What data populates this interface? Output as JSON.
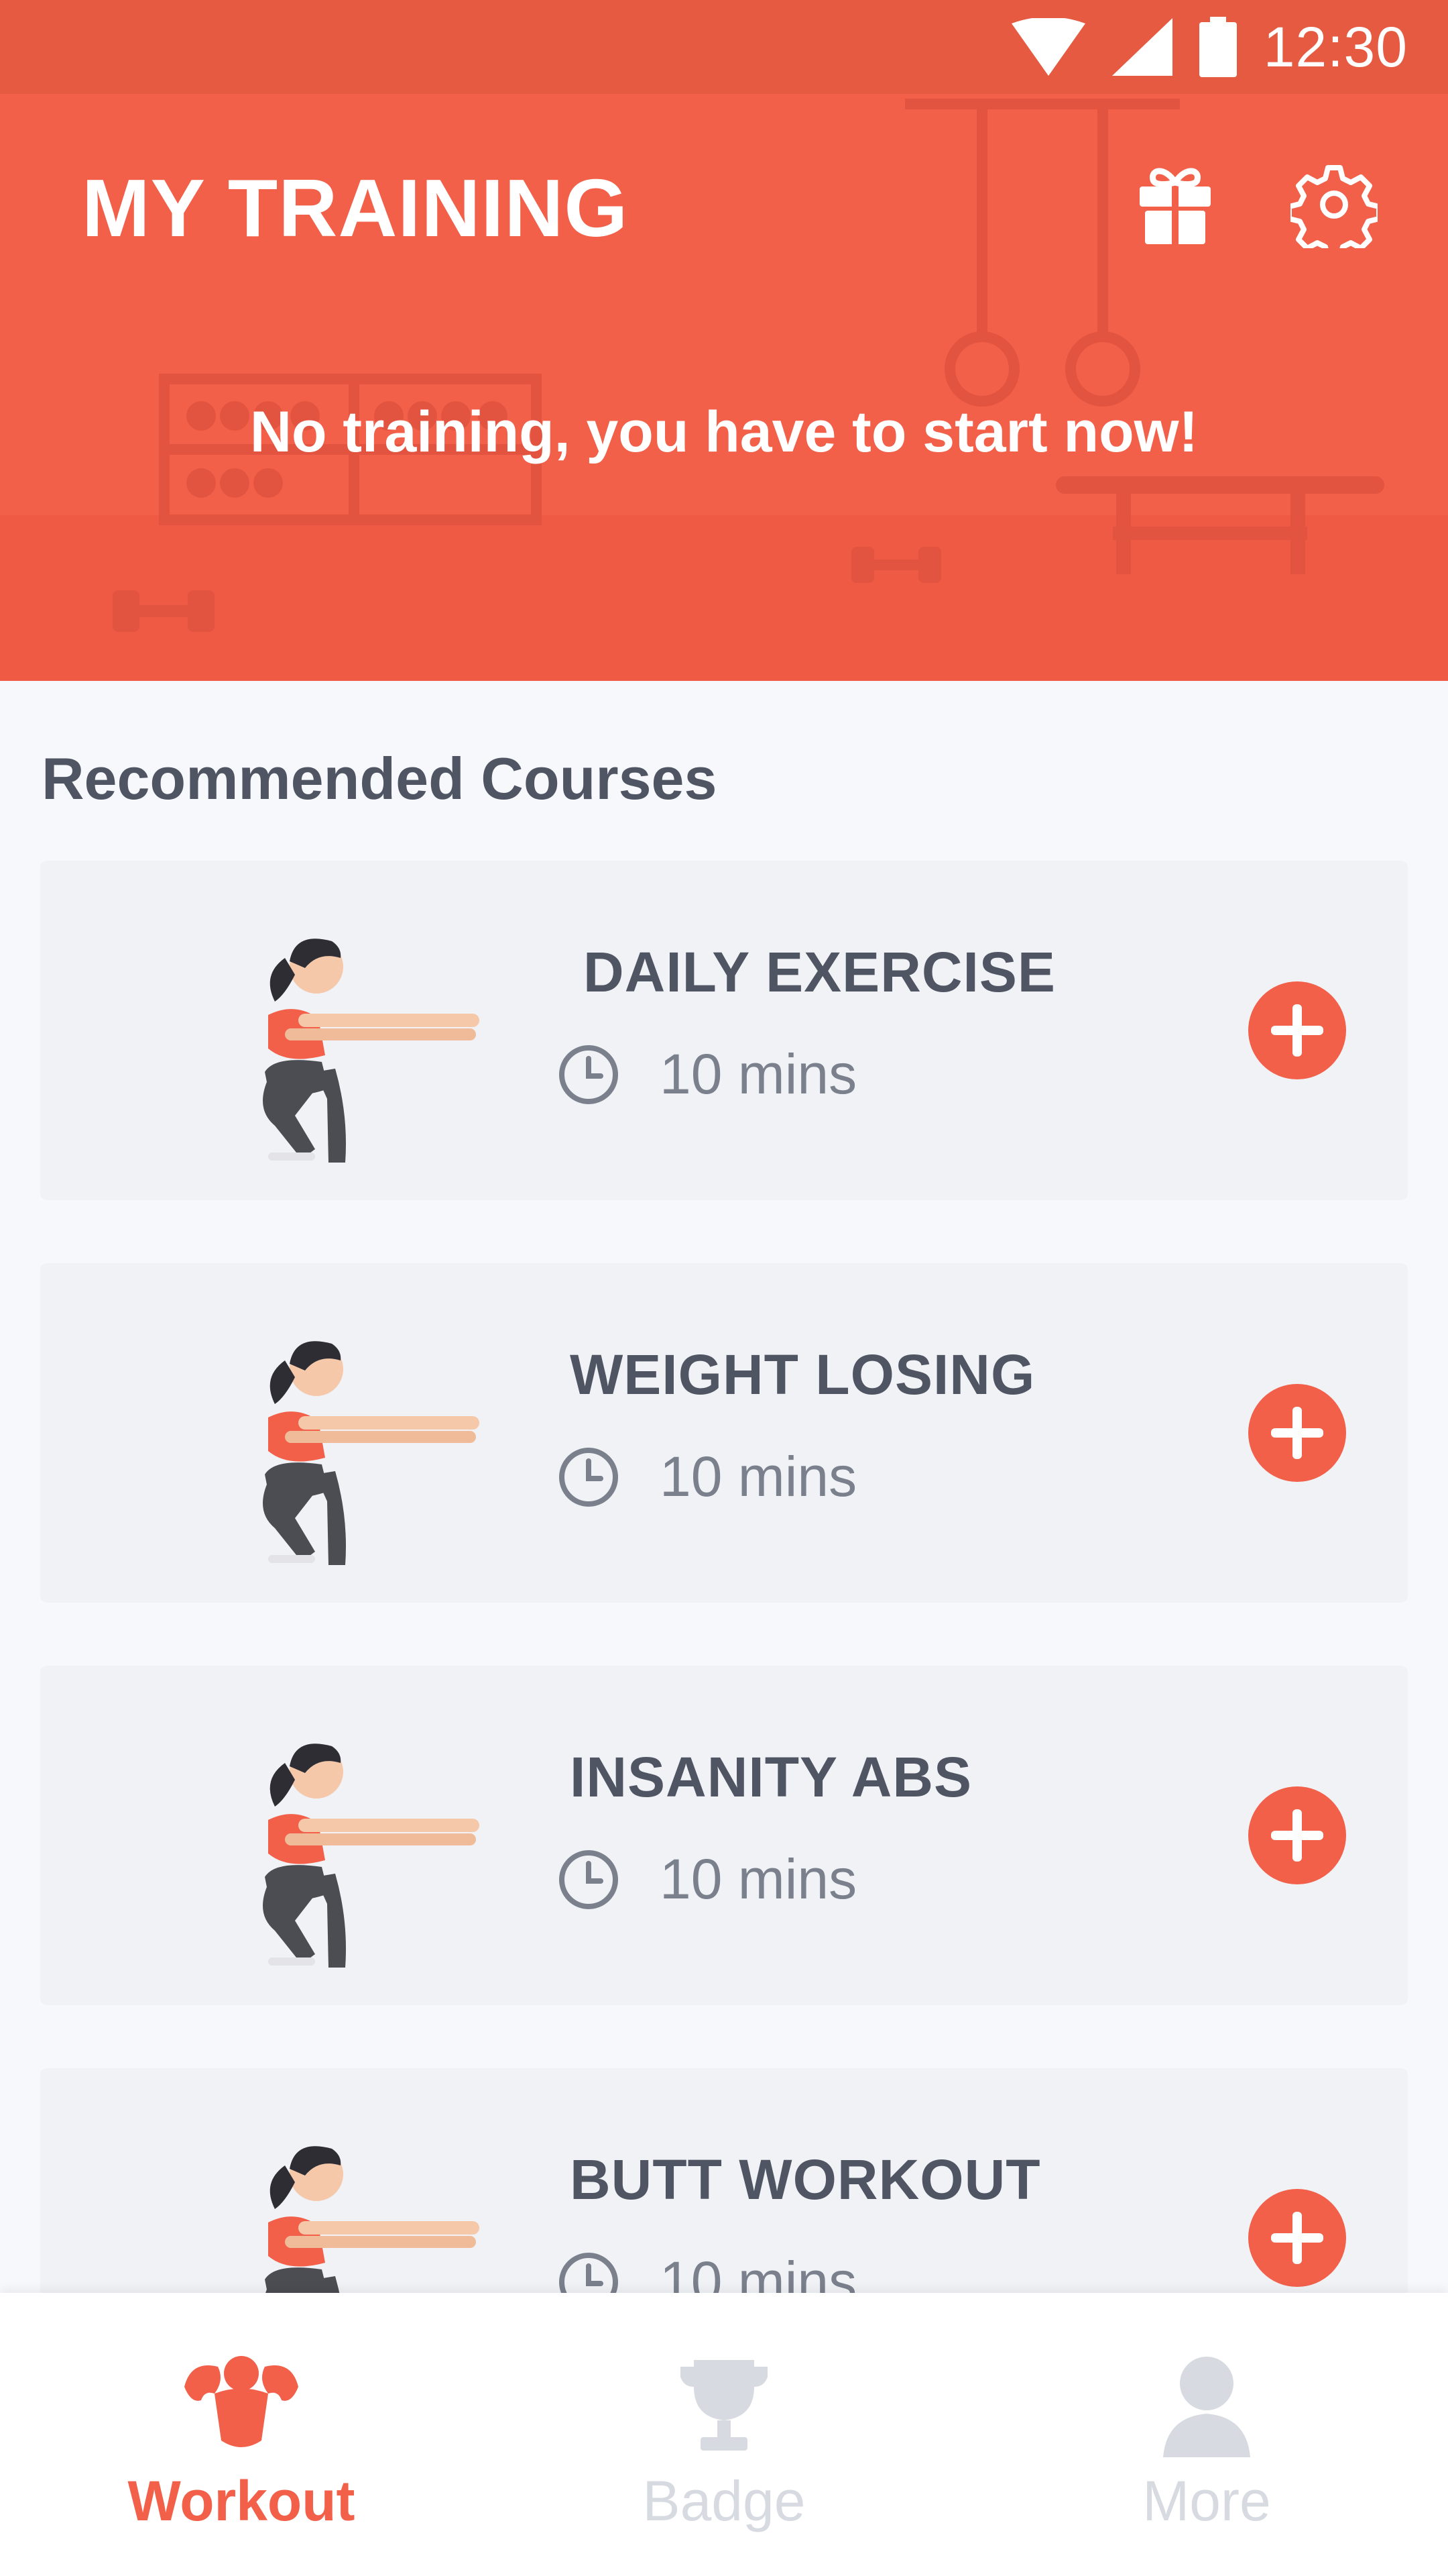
{
  "status_bar": {
    "time": "12:30"
  },
  "header": {
    "title": "MY TRAINING",
    "subtitle": "No training, you have to start now!",
    "gift_icon": "gift-icon",
    "settings_icon": "gear-icon"
  },
  "recommended": {
    "title": "Recommended Courses",
    "courses": [
      {
        "name": "DAILY EXERCISE",
        "duration": "10 mins"
      },
      {
        "name": "WEIGHT LOSING",
        "duration": "10 mins"
      },
      {
        "name": "INSANITY ABS",
        "duration": "10 mins"
      },
      {
        "name": "BUTT WORKOUT",
        "duration": "10 mins"
      }
    ]
  },
  "bottom_nav": {
    "items": [
      {
        "label": "Workout",
        "icon": "muscle-icon",
        "active": true
      },
      {
        "label": "Badge",
        "icon": "trophy-icon",
        "active": false
      },
      {
        "label": "More",
        "icon": "person-icon",
        "active": false
      }
    ]
  },
  "colors": {
    "accent": "#f2604a",
    "status_bar": "#e65a42",
    "background": "#f7f8fb",
    "card": "#f0f2f6",
    "text_dark": "#4f5563",
    "text_muted": "#7a808c",
    "nav_inactive": "#d7dbe1"
  }
}
